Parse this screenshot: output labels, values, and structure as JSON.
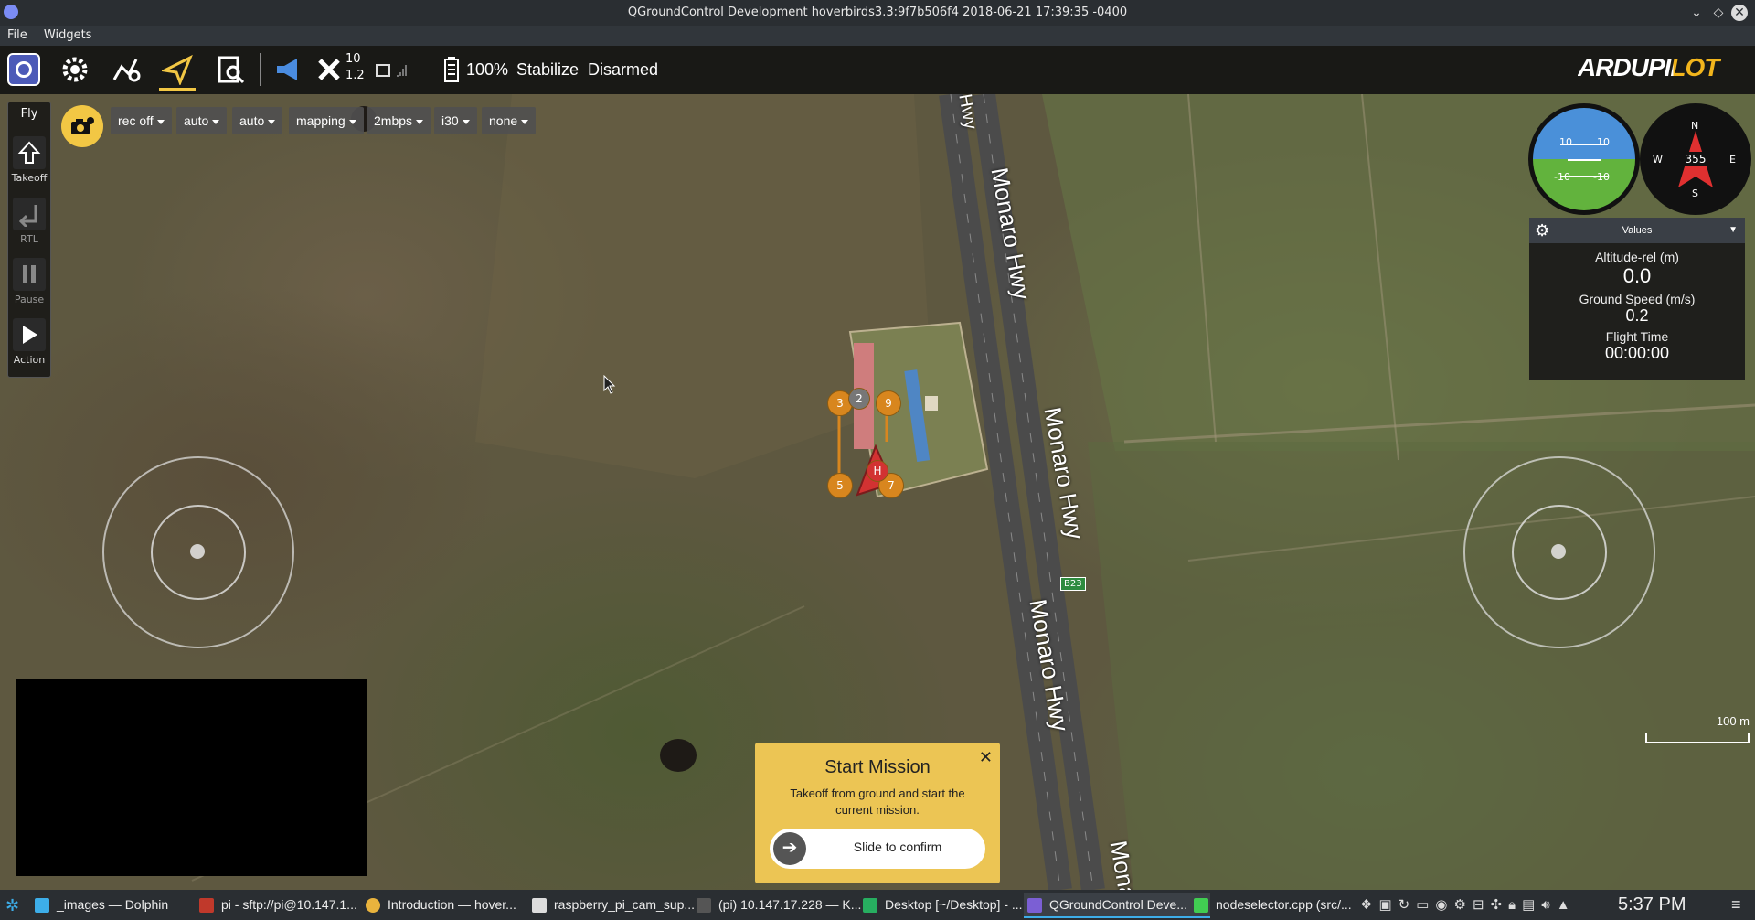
{
  "window": {
    "title": "QGroundControl Development hoverbirds3.3:9f7b506f4 2018-06-21 17:39:35 -0400"
  },
  "menu": {
    "items": [
      "File",
      "Widgets"
    ]
  },
  "toolbar": {
    "sat_count": "10",
    "hdop": "1.2",
    "battery": "100%",
    "flight_mode": "Stabilize",
    "arm_state": "Disarmed",
    "logo_text": "ARDUPILOT"
  },
  "flypanel": {
    "title": "Fly",
    "buttons": [
      {
        "label": "Takeoff",
        "icon": "takeoff-icon"
      },
      {
        "label": "RTL",
        "icon": "rtl-icon"
      },
      {
        "label": "Pause",
        "icon": "pause-icon"
      },
      {
        "label": "Action",
        "icon": "play-icon"
      }
    ]
  },
  "camera": {
    "dropdowns": [
      "rec off",
      "auto",
      "auto",
      "mapping",
      "2mbps",
      "i30",
      "none"
    ]
  },
  "attitude": {
    "pitch_top_left": "10",
    "pitch_top_right": "10",
    "pitch_bottom_left": "-10",
    "pitch_bottom_right": "-10"
  },
  "compass": {
    "heading": "355",
    "n": "N",
    "s": "S",
    "e": "E",
    "w": "W"
  },
  "values_panel": {
    "header": "Values",
    "items": [
      {
        "label": "Altitude-rel (m)",
        "value": "0.0"
      },
      {
        "label": "Ground Speed (m/s)",
        "value": "0.2"
      },
      {
        "label": "Flight Time",
        "value": "00:00:00"
      }
    ]
  },
  "map": {
    "road_labels": [
      "Monaro Hwy",
      "Monaro Hwy",
      "Monaro Hwy",
      "Monaro Hwy",
      "Mona",
      "Hwy"
    ],
    "route_badge": "B23",
    "scale": "100 m",
    "waypoints": [
      "3",
      "2",
      "9",
      "5",
      "7",
      "H"
    ]
  },
  "mission": {
    "title": "Start Mission",
    "text": "Takeoff from ground and start the current mission.",
    "slider": "Slide to confirm",
    "close": "✕"
  },
  "taskbar": {
    "tasks": [
      {
        "label": "_images — Dolphin",
        "color": "#3daee9"
      },
      {
        "label": "pi - sftp://pi@10.147.1...",
        "color": "#c0392b"
      },
      {
        "label": "Introduction — hover...",
        "color": "#e9b33d"
      },
      {
        "label": "raspberry_pi_cam_sup...",
        "color": "#dddddd"
      },
      {
        "label": "(pi) 10.147.17.228 — K...",
        "color": "#555555"
      },
      {
        "label": "Desktop [~/Desktop] - ...",
        "color": "#27ae60"
      },
      {
        "label": "QGroundControl Deve...",
        "color": "#7b5fd4"
      },
      {
        "label": "nodeselector.cpp (src/...",
        "color": "#41cd52"
      }
    ],
    "clock": "5:37 PM"
  }
}
